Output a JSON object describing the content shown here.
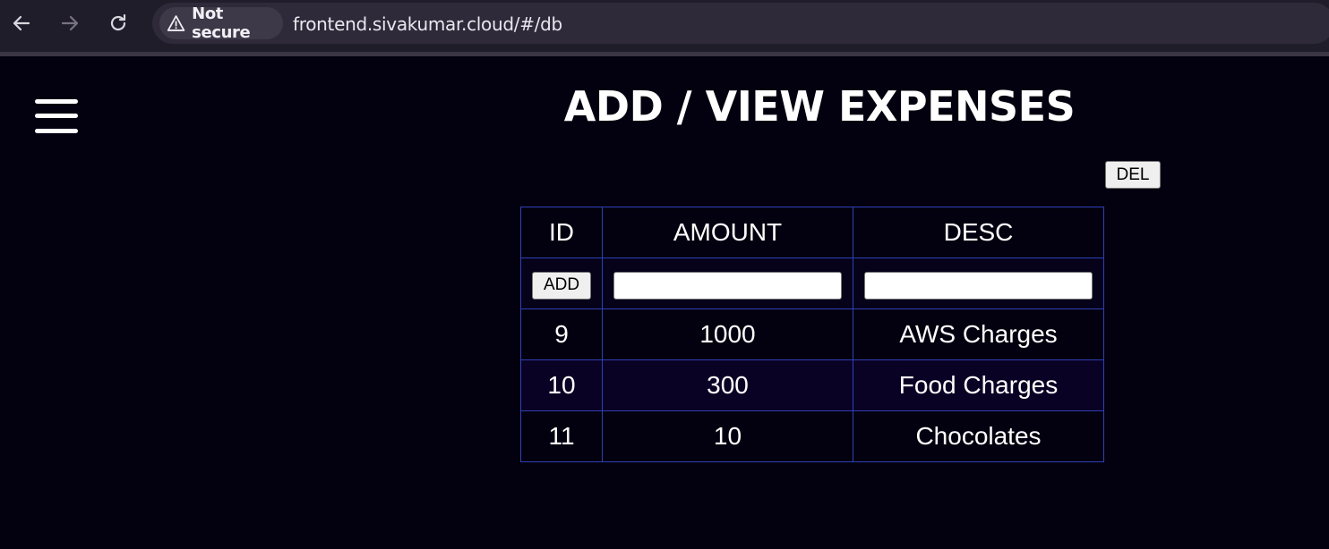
{
  "browser": {
    "security_label": "Not secure",
    "url": "frontend.sivakumar.cloud/#/db",
    "icons": [
      "back-arrow-icon",
      "forward-arrow-icon",
      "reload-icon",
      "warning-triangle-icon"
    ]
  },
  "page": {
    "title": "ADD / VIEW EXPENSES",
    "menu_icon": "hamburger-menu-icon",
    "del_label": "DEL"
  },
  "table": {
    "headers": {
      "id": "ID",
      "amount": "AMOUNT",
      "desc": "DESC"
    },
    "add_label": "ADD",
    "amount_input_value": "",
    "desc_input_value": "",
    "rows": [
      {
        "id": "9",
        "amount": "1000",
        "desc": "AWS Charges"
      },
      {
        "id": "10",
        "amount": "300",
        "desc": "Food Charges"
      },
      {
        "id": "11",
        "amount": "10",
        "desc": "Chocolates"
      }
    ]
  },
  "colors": {
    "background": "#03010f",
    "table_border": "#2f3fb8",
    "text": "#ffffff"
  }
}
